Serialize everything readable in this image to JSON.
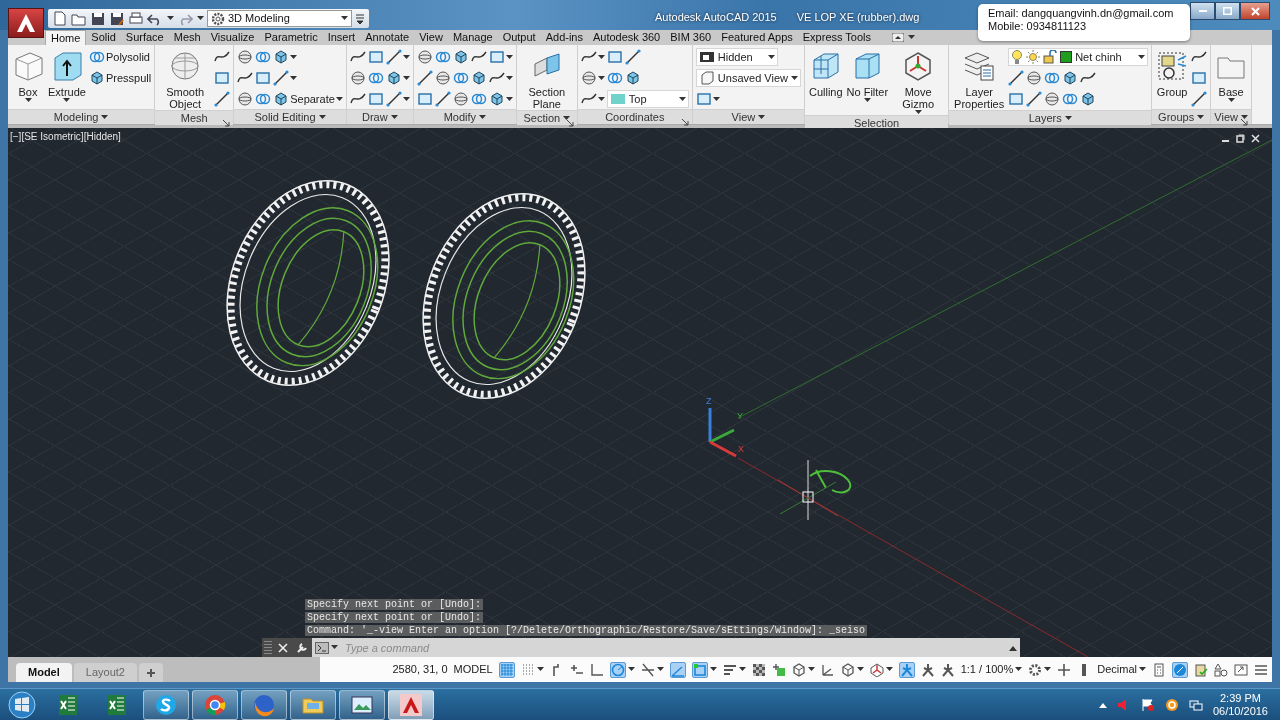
{
  "title_bar": {
    "workspace": "3D Modeling",
    "app": "Autodesk AutoCAD 2015",
    "document": "VE LOP XE (rubber).dwg"
  },
  "tooltip": {
    "lines": [
      "Email: dangquangvinh.dn@gmail.com",
      "Mobile: 0934811123"
    ]
  },
  "ribbon_tabs": [
    {
      "label": "Home",
      "selected": true
    },
    {
      "label": "Solid",
      "selected": false
    },
    {
      "label": "Surface",
      "selected": false
    },
    {
      "label": "Mesh",
      "selected": false
    },
    {
      "label": "Visualize",
      "selected": false
    },
    {
      "label": "Parametric",
      "selected": false
    },
    {
      "label": "Insert",
      "selected": false
    },
    {
      "label": "Annotate",
      "selected": false
    },
    {
      "label": "View",
      "selected": false
    },
    {
      "label": "Manage",
      "selected": false
    },
    {
      "label": "Output",
      "selected": false
    },
    {
      "label": "Add-ins",
      "selected": false
    },
    {
      "label": "Autodesk 360",
      "selected": false
    },
    {
      "label": "BIM 360",
      "selected": false
    },
    {
      "label": "Featured Apps",
      "selected": false
    },
    {
      "label": "Express Tools",
      "selected": false
    }
  ],
  "ribbon_panels": [
    {
      "title": "Modeling",
      "menu": true,
      "launcher": false,
      "segments": [
        {
          "kind": "large",
          "label": "Box",
          "caret": true
        },
        {
          "kind": "large",
          "label": "Extrude",
          "caret": true
        },
        {
          "kind": "rows",
          "rows": [
            [
              {
                "kind": "small",
                "label": "Polysolid",
                "caret": false
              }
            ],
            [
              {
                "kind": "small",
                "label": "Presspull",
                "caret": false
              }
            ]
          ]
        }
      ]
    },
    {
      "title": "Mesh",
      "menu": false,
      "launcher": true,
      "segments": [
        {
          "kind": "large",
          "label": "Smooth Object",
          "caret": false
        },
        {
          "kind": "rows",
          "rows": [
            [
              {
                "kind": "icon",
                "caret": false
              }
            ],
            [
              {
                "kind": "icon",
                "caret": false
              }
            ],
            [
              {
                "kind": "icon",
                "caret": false
              }
            ]
          ]
        }
      ]
    },
    {
      "title": "Solid Editing",
      "menu": true,
      "launcher": false,
      "segments": [
        {
          "kind": "rows",
          "rows": [
            [
              {
                "kind": "icon",
                "caret": false
              },
              {
                "kind": "icon",
                "caret": false
              },
              {
                "kind": "icon",
                "caret": true
              }
            ],
            [
              {
                "kind": "icon",
                "caret": false
              },
              {
                "kind": "icon",
                "caret": false
              },
              {
                "kind": "icon",
                "caret": true
              }
            ],
            [
              {
                "kind": "icon",
                "caret": false
              },
              {
                "kind": "icon",
                "caret": false
              },
              {
                "kind": "small",
                "label": "Separate",
                "caret": true
              }
            ]
          ]
        }
      ]
    },
    {
      "title": "Draw",
      "menu": true,
      "launcher": false,
      "segments": [
        {
          "kind": "rows",
          "rows": [
            [
              {
                "kind": "icon",
                "caret": false
              },
              {
                "kind": "icon",
                "caret": false
              },
              {
                "kind": "icon",
                "caret": true
              }
            ],
            [
              {
                "kind": "icon",
                "caret": false
              },
              {
                "kind": "icon",
                "caret": false
              },
              {
                "kind": "icon",
                "caret": true
              }
            ],
            [
              {
                "kind": "icon",
                "caret": false
              },
              {
                "kind": "icon",
                "caret": false
              },
              {
                "kind": "icon",
                "caret": true
              }
            ]
          ]
        }
      ]
    },
    {
      "title": "Modify",
      "menu": true,
      "launcher": false,
      "segments": [
        {
          "kind": "rows",
          "rows": [
            [
              {
                "kind": "icon",
                "caret": false
              },
              {
                "kind": "icon",
                "caret": false
              },
              {
                "kind": "icon",
                "caret": false
              },
              {
                "kind": "icon",
                "caret": false
              },
              {
                "kind": "icon",
                "caret": true
              }
            ],
            [
              {
                "kind": "icon",
                "caret": false
              },
              {
                "kind": "icon",
                "caret": false
              },
              {
                "kind": "icon",
                "caret": false
              },
              {
                "kind": "icon",
                "caret": false
              },
              {
                "kind": "icon",
                "caret": true
              }
            ],
            [
              {
                "kind": "icon",
                "caret": false
              },
              {
                "kind": "icon",
                "caret": false
              },
              {
                "kind": "icon",
                "caret": false
              },
              {
                "kind": "icon",
                "caret": false
              },
              {
                "kind": "icon",
                "caret": true
              }
            ]
          ]
        }
      ]
    },
    {
      "title": "Section",
      "menu": true,
      "launcher": true,
      "segments": [
        {
          "kind": "large",
          "label": "Section Plane",
          "caret": false
        }
      ]
    },
    {
      "title": "Coordinates",
      "menu": false,
      "launcher": true,
      "segments": [
        {
          "kind": "rows",
          "rows": [
            [
              {
                "kind": "icon",
                "caret": true
              },
              {
                "kind": "icon",
                "caret": false
              },
              {
                "kind": "icon",
                "caret": false
              }
            ],
            [
              {
                "kind": "icon",
                "caret": true
              },
              {
                "kind": "icon",
                "caret": false
              },
              {
                "kind": "icon",
                "caret": false
              }
            ],
            [
              {
                "kind": "icon",
                "caret": true
              },
              {
                "kind": "combo",
                "label": "Top"
              }
            ]
          ]
        }
      ]
    },
    {
      "title": "View",
      "menu": true,
      "launcher": false,
      "segments": [
        {
          "kind": "rows",
          "rows": [
            [
              {
                "kind": "combo",
                "label": "Hidden"
              }
            ],
            [
              {
                "kind": "combo",
                "label": "Unsaved View"
              }
            ],
            [
              {
                "kind": "icon",
                "caret": true
              }
            ]
          ]
        }
      ]
    },
    {
      "title": "Selection",
      "menu": false,
      "launcher": false,
      "segments": [
        {
          "kind": "large",
          "label": "Culling",
          "caret": false
        },
        {
          "kind": "large",
          "label": "No Filter",
          "caret": true
        },
        {
          "kind": "large",
          "label": "Move Gizmo",
          "caret": true
        }
      ]
    },
    {
      "title": "Layers",
      "menu": true,
      "launcher": false,
      "segments": [
        {
          "kind": "large",
          "label": "Layer Properties",
          "caret": false
        },
        {
          "kind": "rows",
          "rows": [
            [
              {
                "kind": "layer_combo",
                "label": "Net chinh"
              }
            ],
            [
              {
                "kind": "icon",
                "caret": false
              },
              {
                "kind": "icon",
                "caret": false
              },
              {
                "kind": "icon",
                "caret": false
              },
              {
                "kind": "icon",
                "caret": false
              },
              {
                "kind": "icon",
                "caret": false
              }
            ],
            [
              {
                "kind": "icon",
                "caret": false
              },
              {
                "kind": "icon",
                "caret": false
              },
              {
                "kind": "icon",
                "caret": false
              },
              {
                "kind": "icon",
                "caret": false
              },
              {
                "kind": "icon",
                "caret": false
              }
            ]
          ]
        }
      ]
    },
    {
      "title": "Groups",
      "menu": true,
      "launcher": false,
      "segments": [
        {
          "kind": "large",
          "label": "Group",
          "caret": false
        },
        {
          "kind": "rows",
          "rows": [
            [
              {
                "kind": "icon",
                "caret": false
              }
            ],
            [
              {
                "kind": "icon",
                "caret": false
              }
            ],
            [
              {
                "kind": "icon",
                "caret": false
              }
            ]
          ]
        }
      ]
    },
    {
      "title": "View",
      "menu": true,
      "launcher": true,
      "segments": [
        {
          "kind": "large",
          "label": "Base",
          "caret": true
        }
      ]
    }
  ],
  "viewport": {
    "controls": [
      "[−]",
      "[SE Isometric]",
      "[Hidden]"
    ],
    "ucs_axes": [
      "Z",
      "Y",
      "X"
    ]
  },
  "command_history": [
    "Specify next point or [Undo]:",
    "Specify next point or [Undo]:",
    "Command: '_-view Enter an option [?/Delete/Orthographic/Restore/Save/sEttings/Window]: _seiso"
  ],
  "command_line": {
    "placeholder": "Type a command"
  },
  "layout_tabs": [
    {
      "label": "Model",
      "selected": true
    },
    {
      "label": "Layout2",
      "selected": false
    }
  ],
  "status_bar": {
    "coordinates": "2580, 31, 0",
    "space": "MODEL",
    "items": [
      {
        "kind": "grid",
        "on": true,
        "caret": false
      },
      {
        "kind": "dots",
        "on": false,
        "caret": true
      },
      {
        "kind": "step",
        "on": false,
        "caret": false
      },
      {
        "kind": "plusline",
        "on": false,
        "caret": false
      },
      {
        "kind": "corner",
        "on": false,
        "caret": false
      },
      {
        "kind": "polar",
        "on": true,
        "caret": true
      },
      {
        "kind": "slash",
        "on": false,
        "caret": true
      },
      {
        "kind": "angle",
        "on": true,
        "caret": false
      },
      {
        "kind": "square",
        "on": true,
        "caret": true
      },
      {
        "kind": "lines",
        "on": false,
        "caret": true
      },
      {
        "kind": "checker",
        "on": false,
        "caret": false
      },
      {
        "kind": "stack",
        "on": false,
        "caret": false
      },
      {
        "kind": "cube",
        "on": false,
        "caret": true
      },
      {
        "kind": "axes",
        "on": false,
        "caret": false
      },
      {
        "kind": "cube",
        "on": false,
        "caret": true
      },
      {
        "kind": "gizmo",
        "on": false,
        "caret": true
      },
      {
        "kind": "figure",
        "on": true,
        "caret": false
      },
      {
        "kind": "figure",
        "on": false,
        "caret": false
      },
      {
        "kind": "figure",
        "on": false,
        "caret": false
      },
      {
        "kind": "text",
        "label": "1:1 / 100%",
        "caret": true
      },
      {
        "kind": "gear",
        "on": false,
        "caret": true
      },
      {
        "kind": "plus",
        "on": false,
        "caret": false
      },
      {
        "kind": "bar",
        "on": false,
        "caret": false
      },
      {
        "kind": "text",
        "label": "Decimal",
        "caret": true
      },
      {
        "kind": "calc",
        "on": false,
        "caret": false
      },
      {
        "kind": "disc",
        "on": true,
        "caret": false
      },
      {
        "kind": "clipboard",
        "on": false,
        "caret": false
      },
      {
        "kind": "shapes",
        "on": false,
        "caret": false
      },
      {
        "kind": "expand",
        "on": false,
        "caret": false
      },
      {
        "kind": "menu",
        "on": false,
        "caret": false
      }
    ]
  },
  "taskbar": {
    "apps": [
      {
        "kind": "spreadsheet",
        "running": false,
        "selected": false
      },
      {
        "kind": "spreadsheet",
        "running": false,
        "selected": false
      },
      {
        "kind": "chat",
        "running": true,
        "selected": false
      },
      {
        "kind": "browser",
        "running": true,
        "selected": false
      },
      {
        "kind": "globe",
        "running": true,
        "selected": false
      },
      {
        "kind": "folder",
        "running": true,
        "selected": false
      },
      {
        "kind": "picture",
        "running": true,
        "selected": false
      },
      {
        "kind": "cad",
        "running": true,
        "selected": true
      }
    ],
    "time": "2:39 PM",
    "date": "06/10/2016"
  }
}
